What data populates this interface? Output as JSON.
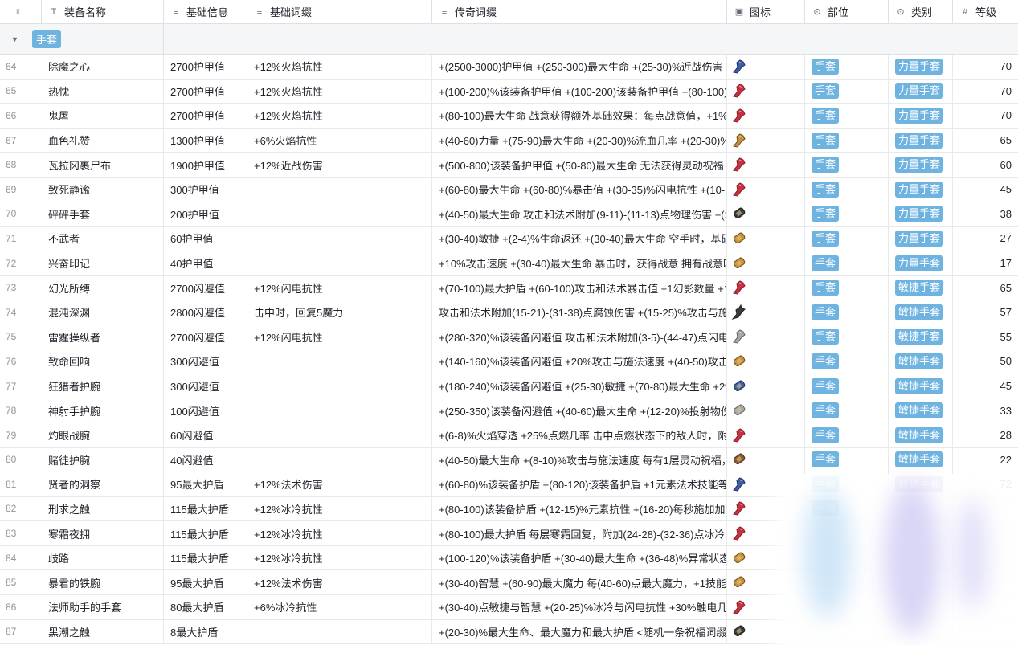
{
  "header": {
    "columns": [
      {
        "key": "lock",
        "label": "",
        "icon": "lock-icon"
      },
      {
        "key": "name",
        "label": "装备名称",
        "icon": "text-field-icon"
      },
      {
        "key": "base",
        "label": "基础信息",
        "icon": "long-text-icon"
      },
      {
        "key": "affix",
        "label": "基础词缀",
        "icon": "long-text-icon"
      },
      {
        "key": "legend",
        "label": "传奇词缀",
        "icon": "long-text-icon"
      },
      {
        "key": "img",
        "label": "图标",
        "icon": "image-icon"
      },
      {
        "key": "slot",
        "label": "部位",
        "icon": "select-icon"
      },
      {
        "key": "type",
        "label": "类别",
        "icon": "select-icon"
      },
      {
        "key": "level",
        "label": "等级",
        "icon": "number-icon"
      }
    ]
  },
  "group": {
    "label": "手套"
  },
  "colors": {
    "tag_blue": "#6fb3e0",
    "tag_purple": "#8e86d9",
    "border": "#dee0e3"
  },
  "rows": [
    {
      "num": "64",
      "name": "除魔之心",
      "base": "2700护甲值",
      "affix": "+12%火焰抗性",
      "legend": "+(2500-3000)护甲值 +(250-300)最大生命 +(25-30)%近战伤害 +(1...",
      "slot": "手套",
      "type": "力量手套",
      "level": "70",
      "icon": "gauntlet-blue-icon"
    },
    {
      "num": "65",
      "name": "热忱",
      "base": "2700护甲值",
      "affix": "+12%火焰抗性",
      "legend": "+(100-200)%该装备护甲值 +(100-200)该装备护甲值 +(80-100)最...",
      "slot": "手套",
      "type": "力量手套",
      "level": "70",
      "icon": "gauntlet-red-icon"
    },
    {
      "num": "66",
      "name": "鬼屠",
      "base": "2700护甲值",
      "affix": "+12%火焰抗性",
      "legend": "+(80-100)最大生命 战意获得额外基础效果：每点战意值，+1%技...",
      "slot": "手套",
      "type": "力量手套",
      "level": "70",
      "icon": "gauntlet-red-icon"
    },
    {
      "num": "67",
      "name": "血色礼赞",
      "base": "1300护甲值",
      "affix": "+6%火焰抗性",
      "legend": "+(40-60)力量 +(75-90)最大生命 +(20-30)%流血几率 +(20-30)%流...",
      "slot": "手套",
      "type": "力量手套",
      "level": "65",
      "icon": "gauntlet-gold-icon"
    },
    {
      "num": "68",
      "name": "瓦拉冈裹尸布",
      "base": "1900护甲值",
      "affix": "+12%近战伤害",
      "legend": "+(500-800)该装备护甲值 +(50-80)最大生命 无法获得灵动祝福 每...",
      "slot": "手套",
      "type": "力量手套",
      "level": "60",
      "icon": "gauntlet-red-icon"
    },
    {
      "num": "69",
      "name": "致死静谧",
      "base": "300护甲值",
      "affix": "",
      "legend": "+(60-80)最大生命 +(60-80)%暴击值 +(30-35)%闪电抗性 +(10-15)...",
      "slot": "手套",
      "type": "力量手套",
      "level": "45",
      "icon": "gauntlet-red-icon"
    },
    {
      "num": "70",
      "name": "砰砰手套",
      "base": "200护甲值",
      "affix": "",
      "legend": "+(40-50)最大生命 攻击和法术附加(9-11)-(11-13)点物理伤害 +(20-...",
      "slot": "手套",
      "type": "力量手套",
      "level": "38",
      "icon": "bracer-dark-icon"
    },
    {
      "num": "71",
      "name": "不武者",
      "base": "60护甲值",
      "affix": "",
      "legend": "+(30-40)敏捷 +(2-4)%生命返还 +(30-40)最大生命 空手时，基础攻...",
      "slot": "手套",
      "type": "力量手套",
      "level": "27",
      "icon": "bracer-gold-icon"
    },
    {
      "num": "72",
      "name": "兴奋印记",
      "base": "40护甲值",
      "affix": "",
      "legend": "+10%攻击速度 +(30-40)最大生命 暴击时，获得战意 拥有战意时，...",
      "slot": "手套",
      "type": "力量手套",
      "level": "17",
      "icon": "bracer-gold-icon"
    },
    {
      "num": "73",
      "name": "幻光所缚",
      "base": "2700闪避值",
      "affix": "+12%闪电抗性",
      "legend": "+(70-100)最大护盾 +(60-100)攻击和法术暴击值 +1幻影数量 +100...",
      "slot": "手套",
      "type": "敏捷手套",
      "level": "65",
      "icon": "gauntlet-red-icon"
    },
    {
      "num": "74",
      "name": "混沌深渊",
      "base": "2800闪避值",
      "affix": "击中时，回复5魔力",
      "legend": "攻击和法术附加(15-21)-(31-38)点腐蚀伤害 +(15-25)%攻击与施法...",
      "slot": "手套",
      "type": "敏捷手套",
      "level": "57",
      "icon": "claw-dark-icon"
    },
    {
      "num": "75",
      "name": "雷霆操纵者",
      "base": "2700闪避值",
      "affix": "+12%闪电抗性",
      "legend": "+(280-320)%该装备闪避值 攻击和法术附加(3-5)-(44-47)点闪电伤...",
      "slot": "手套",
      "type": "敏捷手套",
      "level": "55",
      "icon": "gauntlet-silver-icon"
    },
    {
      "num": "76",
      "name": "致命回响",
      "base": "300闪避值",
      "affix": "",
      "legend": "+(140-160)%该装备闪避值 +20%攻击与施法速度 +(40-50)攻击和...",
      "slot": "手套",
      "type": "敏捷手套",
      "level": "50",
      "icon": "bracer-gold-icon"
    },
    {
      "num": "77",
      "name": "狂猎者护腕",
      "base": "300闪避值",
      "affix": "",
      "legend": "+(180-240)%该装备闪避值 +(25-30)敏捷 +(70-80)最大生命 +2%生...",
      "slot": "手套",
      "type": "敏捷手套",
      "level": "45",
      "icon": "bracer-blue-icon"
    },
    {
      "num": "78",
      "name": "神射手护腕",
      "base": "100闪避值",
      "affix": "",
      "legend": "+(250-350)该装备闪避值 +(40-60)最大生命 +(12-20)%投射物伤害 ...",
      "slot": "手套",
      "type": "敏捷手套",
      "level": "33",
      "icon": "bracer-silver-icon"
    },
    {
      "num": "79",
      "name": "灼眼战腕",
      "base": "60闪避值",
      "affix": "",
      "legend": "+(6-8)%火焰穿透 +25%点燃几率 击中点燃状态下的敌人时，附加...",
      "slot": "手套",
      "type": "敏捷手套",
      "level": "28",
      "icon": "gauntlet-red-icon"
    },
    {
      "num": "80",
      "name": "赌徒护腕",
      "base": "40闪避值",
      "affix": "",
      "legend": "+(40-50)最大生命 +(8-10)%攻击与施法速度 每有1层灵动祝福，+(...",
      "slot": "手套",
      "type": "敏捷手套",
      "level": "22",
      "icon": "bracer-brown-icon"
    },
    {
      "num": "81",
      "name": "贤者的洞察",
      "base": "95最大护盾",
      "affix": "+12%法术伤害",
      "legend": "+(60-80)%该装备护盾 +(80-120)该装备护盾 +1元素法术技能等级 ...",
      "slot": "手套",
      "type": "智慧手套",
      "level": "72",
      "icon": "gauntlet-blue-icon"
    },
    {
      "num": "82",
      "name": "刑求之触",
      "base": "115最大护盾",
      "affix": "+12%冰冷抗性",
      "legend": "+(80-100)该装备护盾 +(12-15)%元素抗性 +(16-20)每秒施加加剧...",
      "slot": "手套",
      "type": "",
      "level": "",
      "icon": "gauntlet-red-icon"
    },
    {
      "num": "83",
      "name": "寒霜夜拥",
      "base": "115最大护盾",
      "affix": "+12%冰冷抗性",
      "legend": "+(80-100)最大护盾 每层寒霜回复，附加(24-28)-(32-36)点冰冷基础...",
      "slot": "",
      "type": "",
      "level": "",
      "icon": "gauntlet-red-icon"
    },
    {
      "num": "84",
      "name": "歧路",
      "base": "115最大护盾",
      "affix": "+12%冰冷抗性",
      "legend": "+(100-120)%该装备护盾 +(30-40)最大生命 +(36-48)%异常状态持...",
      "slot": "",
      "type": "",
      "level": "",
      "icon": "bracer-gold-icon"
    },
    {
      "num": "85",
      "name": "暴君的铁腕",
      "base": "95最大护盾",
      "affix": "+12%法术伤害",
      "legend": "+(30-40)智慧 +(60-90)最大魔力 每(40-60)点最大魔力，+1技能魔...",
      "slot": "",
      "type": "",
      "level": "",
      "icon": "bracer-gold-icon"
    },
    {
      "num": "86",
      "name": "法师助手的手套",
      "base": "80最大护盾",
      "affix": "+6%冰冷抗性",
      "legend": "+(30-40)点敏捷与智慧 +(20-25)%冰冷与闪电抗性 +30%触电几率 ...",
      "slot": "",
      "type": "",
      "level": "",
      "icon": "gauntlet-red-icon"
    },
    {
      "num": "87",
      "name": "黑潮之触",
      "base": "8最大护盾",
      "affix": "",
      "legend": "+(20-30)%最大生命、最大魔力和最大护盾 <随机一条祝福词缀> <...",
      "slot": "",
      "type": "",
      "level": "",
      "icon": "bracer-dark-icon"
    }
  ]
}
